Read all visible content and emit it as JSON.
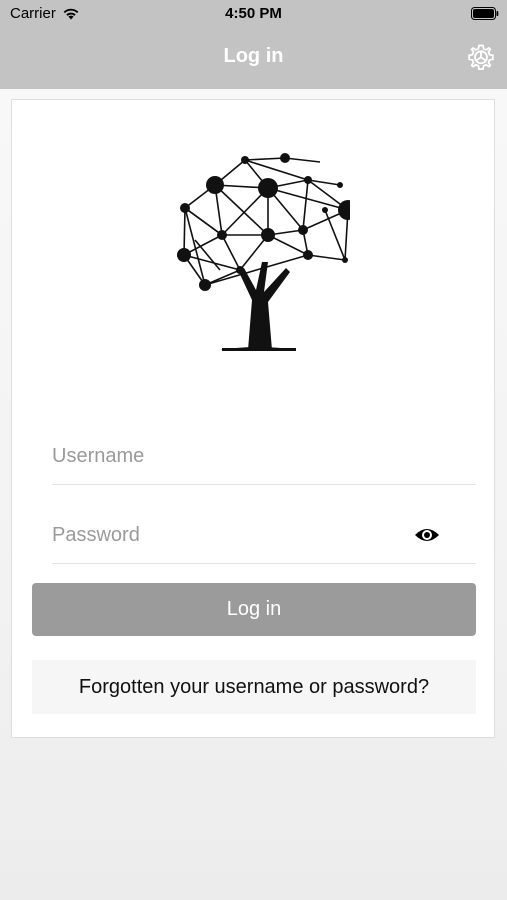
{
  "status_bar": {
    "carrier": "Carrier",
    "time": "4:50 PM"
  },
  "nav": {
    "title": "Log in",
    "settings_icon": "gear-icon"
  },
  "logo": {
    "icon": "network-tree-logo"
  },
  "form": {
    "username_placeholder": "Username",
    "username_value": "",
    "password_placeholder": "Password",
    "password_value": "",
    "password_visibility_icon": "eye-icon",
    "login_label": "Log in",
    "forgot_label": "Forgotten your username or password?"
  },
  "colors": {
    "header_bg": "#c3c3c3",
    "login_button_bg": "#9b9b9b",
    "forgot_button_bg": "#f6f6f6"
  }
}
